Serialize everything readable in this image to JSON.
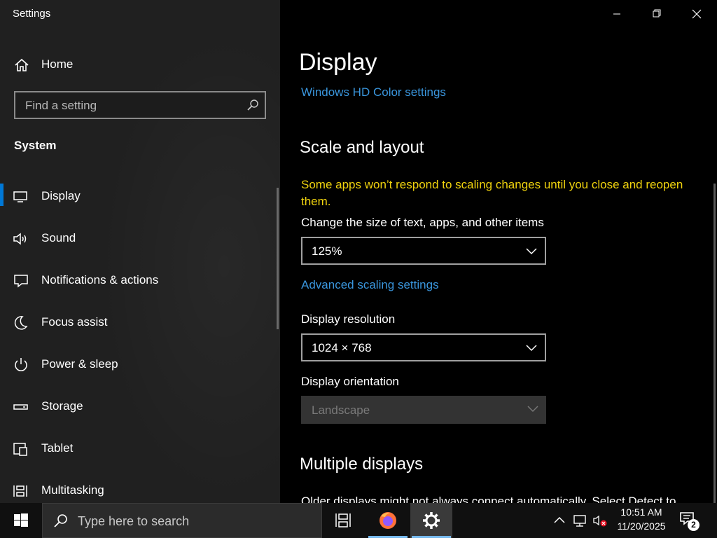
{
  "window": {
    "title": "Settings",
    "minimize_icon": "minimize-icon",
    "maximize_icon": "restore-icon",
    "close_icon": "close-icon"
  },
  "sidebar": {
    "home_label": "Home",
    "search_placeholder": "Find a setting",
    "section": "System",
    "items": [
      {
        "label": "Display",
        "icon": "monitor-icon",
        "active": true
      },
      {
        "label": "Sound",
        "icon": "speaker-icon"
      },
      {
        "label": "Notifications & actions",
        "icon": "notification-icon"
      },
      {
        "label": "Focus assist",
        "icon": "moon-icon"
      },
      {
        "label": "Power & sleep",
        "icon": "power-icon"
      },
      {
        "label": "Storage",
        "icon": "storage-icon"
      },
      {
        "label": "Tablet",
        "icon": "tablet-icon"
      },
      {
        "label": "Multitasking",
        "icon": "multitasking-icon"
      }
    ]
  },
  "main": {
    "title": "Display",
    "hd_color_link": "Windows HD Color settings",
    "scale_heading": "Scale and layout",
    "warning": "Some apps won’t respond to scaling changes until you close and reopen them.",
    "scale_label": "Change the size of text, apps, and other items",
    "scale_value": "125%",
    "advanced_link": "Advanced scaling settings",
    "resolution_label": "Display resolution",
    "resolution_value": "1024 × 768",
    "orientation_label": "Display orientation",
    "orientation_value": "Landscape",
    "multiple_heading": "Multiple displays",
    "multiple_text": "Older displays might not always connect automatically. Select Detect to"
  },
  "taskbar": {
    "search_placeholder": "Type here to search",
    "time": "10:51 AM",
    "date": "11/20/2025",
    "notification_count": "2"
  },
  "colors": {
    "accent": "#0078d7",
    "link": "#3a96dd",
    "warning": "#f0d30e",
    "sidebar_bg": "#202020",
    "main_bg": "#000000"
  }
}
